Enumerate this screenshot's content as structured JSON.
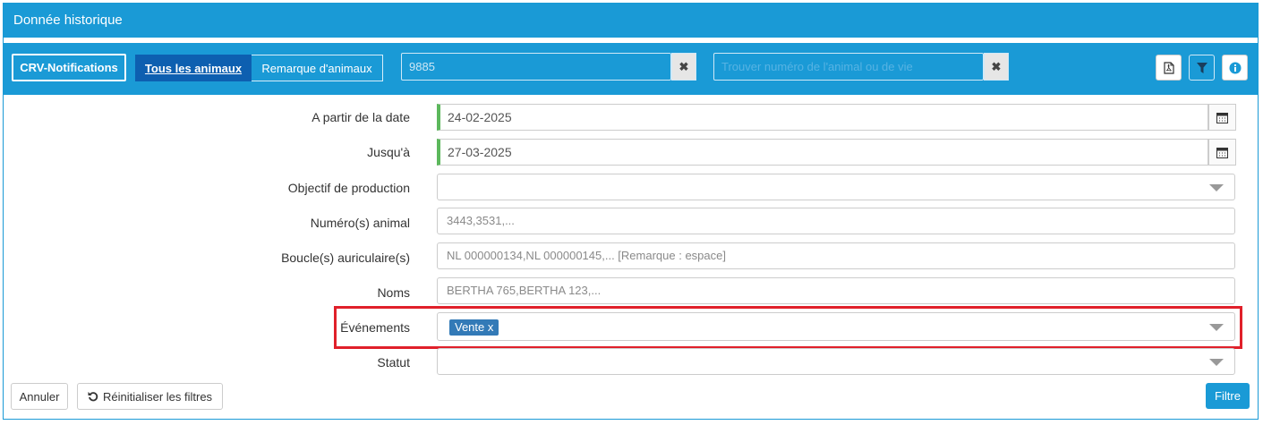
{
  "window": {
    "title": "Donnée historique"
  },
  "toolbar": {
    "crv_button": "CRV-Notifications",
    "tab_all": "Tous les animaux",
    "tab_remarks": "Remarque d'animaux",
    "search_animal_value": "9885",
    "search_number_placeholder": "Trouver numéro de l'animal ou de vie",
    "clear_symbol": "✖",
    "pdf_icon": "pdf-icon",
    "filter_icon": "filter-icon",
    "info_icon": "info-icon"
  },
  "form": {
    "from_date": {
      "label": "A partir de la date",
      "value": "24-02-2025"
    },
    "to_date": {
      "label": "Jusqu'à",
      "value": "27-03-2025"
    },
    "production_goal": {
      "label": "Objectif de production",
      "value": ""
    },
    "animal_numbers": {
      "label": "Numéro(s) animal",
      "placeholder": "3443,3531,..."
    },
    "ear_tags": {
      "label": "Boucle(s) auriculaire(s)",
      "placeholder": "NL 000000134,NL 000000145,... [Remarque : espace]"
    },
    "names": {
      "label": "Noms",
      "placeholder": "BERTHA 765,BERTHA 123,..."
    },
    "events": {
      "label": "Événements",
      "selected_tag": "Vente x"
    },
    "status": {
      "label": "Statut",
      "value": ""
    }
  },
  "footer": {
    "cancel": "Annuler",
    "reset": "Réinitialiser les filtres",
    "filter": "Filtre"
  },
  "colors": {
    "primary": "#1a9ad6",
    "active_tab": "#0d5fb0",
    "tag": "#337ab7",
    "highlight": "#e0202a",
    "date_accent": "#5cb85c"
  }
}
